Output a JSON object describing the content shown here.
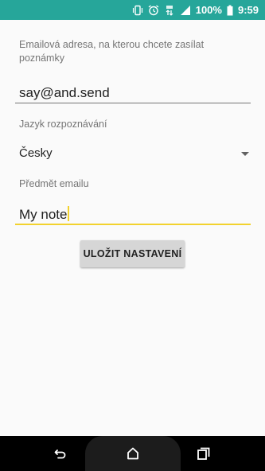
{
  "statusbar": {
    "battery_text": "100%",
    "time": "9:59",
    "icons": [
      "vibrate-icon",
      "alarm-icon",
      "network-4g-icon",
      "signal-icon",
      "battery-icon"
    ]
  },
  "form": {
    "email_label": "Emailová adresa, na kterou chcete zasílat poznámky",
    "email_value": "say@and.send",
    "language_label": "Jazyk rozpoznávání",
    "language_value": "Česky",
    "subject_label": "Předmět emailu",
    "subject_value": "My note",
    "save_label": "ULOŽIT NASTAVENÍ"
  },
  "navbar": {
    "icons": [
      "back-icon",
      "home-icon",
      "recents-icon"
    ]
  },
  "colors": {
    "statusbar": "#26a69a",
    "accent": "#f2d22e",
    "background": "#fafafa",
    "button": "#d6d6d6"
  }
}
